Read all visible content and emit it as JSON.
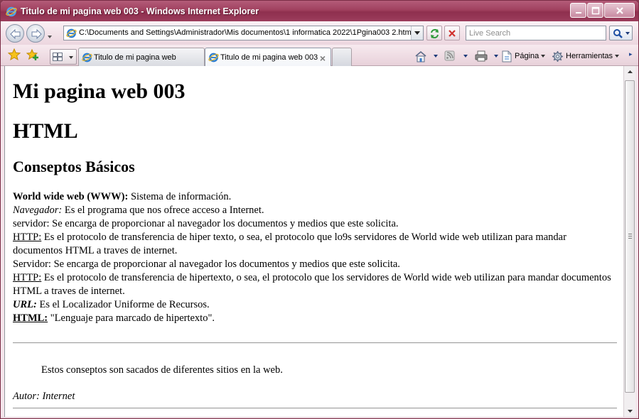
{
  "window": {
    "title": "Titulo de mi pagina web 003 - Windows Internet Explorer"
  },
  "navbar": {
    "address_url": "C:\\Documents and Settings\\Administrador\\Mis documentos\\1 informatica 2022\\1Pgina003  2.html",
    "search_placeholder": "Live Search"
  },
  "tabs": [
    {
      "label": "Titulo de mi pagina web",
      "active": false
    },
    {
      "label": "Titulo de mi pagina web 003",
      "active": true
    }
  ],
  "commandbar": {
    "page_label": "Página",
    "tools_label": "Herramientas"
  },
  "page": {
    "h1": "Mi pagina web 003",
    "h1b": "HTML",
    "h2": "Conseptos Básicos",
    "lines": {
      "www_term": "World wide web (WWW):",
      "www_def": " Sistema de información.",
      "nav_term": "Navegador:",
      "nav_def": " Es el programa que nos ofrece acceso a Internet.",
      "servidor1": "servidor: Se encarga de proporcionar al navegador los documentos y medios que este solicita.",
      "http1_term": "HTTP:",
      "http1_def": " Es el protocolo de transferencia de hiper texto, o sea, el protocolo que lo9s servidores de World wide web utilizan para mandar documentos HTML a traves de internet.",
      "servidor2": "Servidor: Se encarga de proporcionar al navegador los documentos y medios que este solicita.",
      "http2_term": "HTTP:",
      "http2_def": " Es el protocolo de transferencia de hipertexto, o sea, el protocolo que los servidores de World wide web utilizan para mandar documentos HTML a traves de internet.",
      "url_term": "URL:",
      "url_def": " Es el Localizador Uniforme de Recursos.",
      "html_term": "HTML:",
      "html_def": " \"Lenguaje para marcado de hipertexto\"."
    },
    "blockquote": "Estos conseptos son sacados de diferentes sitios en la web.",
    "author": "Autor: Internet"
  },
  "icons": {
    "browser": "ie-icon",
    "back": "back-arrow-icon",
    "forward": "forward-arrow-icon",
    "refresh": "refresh-icon",
    "stop": "stop-icon",
    "search": "search-icon",
    "favorites": "star-icon",
    "add_favorite": "add-favorite-icon",
    "home": "home-icon",
    "feeds": "feed-icon",
    "print": "printer-icon",
    "page": "page-icon",
    "tools": "gear-icon"
  },
  "colors": {
    "titlebar": "#9b3d5c",
    "chrome": "#f4e6ec",
    "link_blue": "#1d3b7a"
  }
}
